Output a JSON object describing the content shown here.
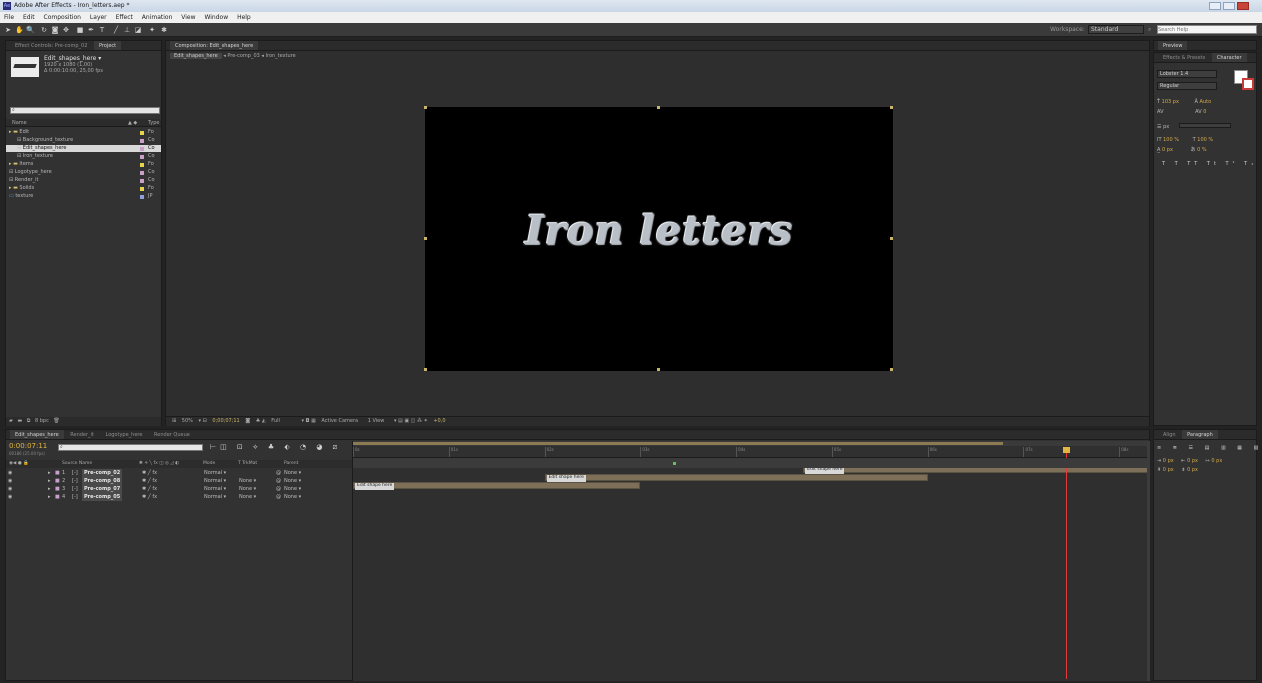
{
  "window": {
    "title": "Adobe After Effects - Iron_letters.aep *",
    "logo": "Ae"
  },
  "menu": [
    "File",
    "Edit",
    "Composition",
    "Layer",
    "Effect",
    "Animation",
    "View",
    "Window",
    "Help"
  ],
  "toolbar": {
    "workspace_label": "Workspace:",
    "workspace_value": "Standard",
    "search_placeholder": "Search Help"
  },
  "project": {
    "tabs": [
      "Effect Controls: Pre-comp_02",
      "Project"
    ],
    "item_name": "Edit_shapes_here ▾",
    "item_res": "1920 x 1080 (1,00)",
    "item_dur": "Δ 0:00:10:00, 25,00 fps",
    "col_name": "Name",
    "col_type": "Type",
    "items": [
      {
        "name": "Edit",
        "type": "Fo",
        "color": "#e8d44a",
        "indent": 0,
        "kind": "folder"
      },
      {
        "name": "Background_texture",
        "type": "Co",
        "color": "#c9a0c9",
        "indent": 1,
        "kind": "comp"
      },
      {
        "name": "Edit_shapes_here",
        "type": "Co",
        "color": "#c9a0c9",
        "indent": 1,
        "kind": "comp",
        "selected": true
      },
      {
        "name": "Iron_texture",
        "type": "Co",
        "color": "#c9a0c9",
        "indent": 1,
        "kind": "comp"
      },
      {
        "name": "Items",
        "type": "Fo",
        "color": "#e8d44a",
        "indent": 0,
        "kind": "folder"
      },
      {
        "name": "Logotype_here",
        "type": "Co",
        "color": "#c9a0c9",
        "indent": 0,
        "kind": "comp"
      },
      {
        "name": "Render_it",
        "type": "Co",
        "color": "#c9a0c9",
        "indent": 0,
        "kind": "comp"
      },
      {
        "name": "Solids",
        "type": "Fo",
        "color": "#e8d44a",
        "indent": 0,
        "kind": "folder"
      },
      {
        "name": "texture",
        "type": "JP",
        "color": "#8f9fe0",
        "indent": 0,
        "kind": "image"
      }
    ],
    "footer_bpc": "8 bpc"
  },
  "composition": {
    "tab": "Composition: Edit_shapes_here",
    "breadcrumbs": [
      "Edit_shapes_here",
      "Pre-comp_03",
      "Iron_texture"
    ],
    "text": "Iron letters",
    "zoom": "50%",
    "timecode": "0;00;07;11",
    "resolution": "Full",
    "camera": "Active Camera",
    "views": "1 View",
    "exposure": "+0,0"
  },
  "right_panel": {
    "tabs": [
      "Preview"
    ],
    "tabs2": [
      "Effects & Presets",
      "Character"
    ],
    "font": "Lobster 1.4",
    "style": "Regular",
    "size": "103 px",
    "leading": "Auto",
    "tracking": "0",
    "scale_v": "100 %",
    "scale_h": "100 %",
    "baseline": "0 px",
    "tsume": "0 %",
    "unit": "px",
    "para_tabs": [
      "Align",
      "Paragraph"
    ],
    "indent_values": [
      "0 px",
      "0 px",
      "0 px",
      "0 px",
      "0 px"
    ]
  },
  "timeline": {
    "tabs": [
      "Edit_shapes_here",
      "Render_it",
      "Logotype_here",
      "Render Queue"
    ],
    "timecode": "0:00:07:11",
    "timecode_sub": "00186 (25.00 fps)",
    "col_source": "Source Name",
    "col_mode": "Mode",
    "col_trkmat": "T TrkMat",
    "col_parent": "Parent",
    "layers": [
      {
        "num": "1",
        "name": "Pre-comp_02",
        "mode": "Normal",
        "trkmat": "",
        "parent": "None"
      },
      {
        "num": "2",
        "name": "Pre-comp_08",
        "mode": "Normal",
        "trkmat": "None",
        "parent": "None"
      },
      {
        "num": "3",
        "name": "Pre-comp_07",
        "mode": "Normal",
        "trkmat": "None",
        "parent": "None"
      },
      {
        "num": "4",
        "name": "Pre-comp_05",
        "mode": "Normal",
        "trkmat": "None",
        "parent": "None"
      }
    ],
    "ruler": [
      "0s",
      "01s",
      "02s",
      "03s",
      "04s",
      "05s",
      "06s",
      "07s",
      "08s"
    ],
    "bar_label": "Edit shape here",
    "bars": [
      {
        "start": 7.0,
        "end": 8.3
      },
      {
        "start": 4.7,
        "end": 8.3
      },
      {
        "start": 2.0,
        "end": 6.0
      },
      {
        "start": 0.0,
        "end": 3.0
      }
    ],
    "playhead": 7.44,
    "duration_s": 8.3
  }
}
